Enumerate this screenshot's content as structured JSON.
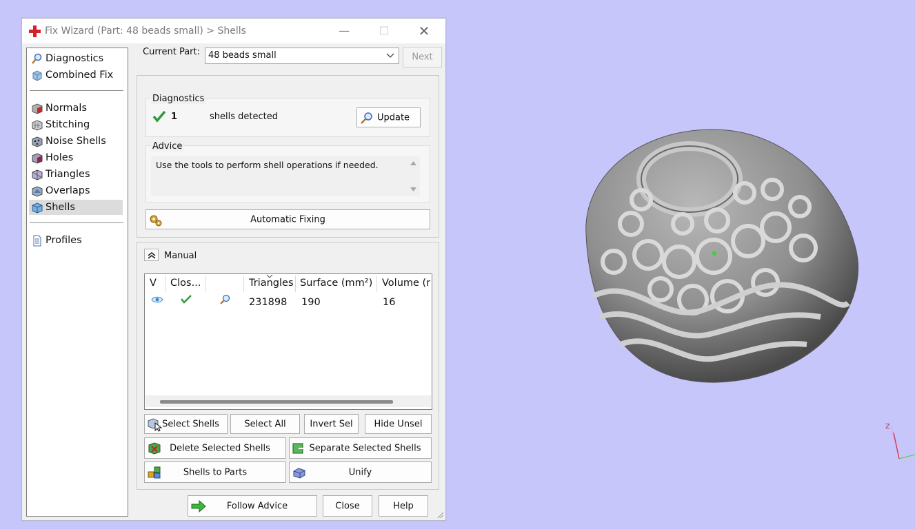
{
  "window": {
    "title": "Fix Wizard (Part: 48 beads small) > Shells",
    "buttons": {
      "minimize": "—",
      "maximize": "☐",
      "close": "✕"
    }
  },
  "sidebar": {
    "items": [
      {
        "label": "Diagnostics",
        "icon": "magnifier-icon"
      },
      {
        "label": "Combined Fix",
        "icon": "cube-icon"
      },
      {
        "label": "Normals",
        "icon": "cube-red-icon"
      },
      {
        "label": "Stitching",
        "icon": "stitching-icon"
      },
      {
        "label": "Noise Shells",
        "icon": "noise-shells-icon"
      },
      {
        "label": "Holes",
        "icon": "holes-icon"
      },
      {
        "label": "Triangles",
        "icon": "triangles-icon"
      },
      {
        "label": "Overlaps",
        "icon": "overlaps-icon"
      },
      {
        "label": "Shells",
        "icon": "shells-icon",
        "active": true
      },
      {
        "label": "Profiles",
        "icon": "document-icon"
      }
    ]
  },
  "current_part": {
    "label": "Current Part:",
    "value": "48 beads small",
    "next_label": "Next"
  },
  "diagnostics": {
    "title": "Diagnostics",
    "count": "1",
    "text": "shells detected",
    "update_label": "Update"
  },
  "advice": {
    "title": "Advice",
    "text": "Use the tools to perform shell operations if needed."
  },
  "automatic_fixing_label": "Automatic Fixing",
  "manual": {
    "label": "Manual",
    "collapse_symbol": "⌃"
  },
  "table": {
    "columns": [
      "V",
      "Clos...",
      "",
      "Triangles",
      "Surface (mm²)",
      "Volume (m"
    ],
    "rows": [
      {
        "triangles": "231898",
        "surface": "190",
        "volume": "16"
      }
    ]
  },
  "buttons": {
    "select_shells": "Select Shells",
    "select_all": "Select All",
    "invert_sel": "Invert Sel",
    "hide_unsel": "Hide Unsel",
    "delete_selected": "Delete Selected Shells",
    "separate_selected": "Separate Selected Shells",
    "shells_to_parts": "Shells to Parts",
    "unify": "Unify",
    "follow_advice": "Follow Advice",
    "close": "Close",
    "help": "Help"
  },
  "colors": {
    "background": "#c6c6fa",
    "check_green": "#2e9a3c",
    "model_gray": "#8c8c8c"
  },
  "axis_labels": {
    "z": "Z"
  }
}
